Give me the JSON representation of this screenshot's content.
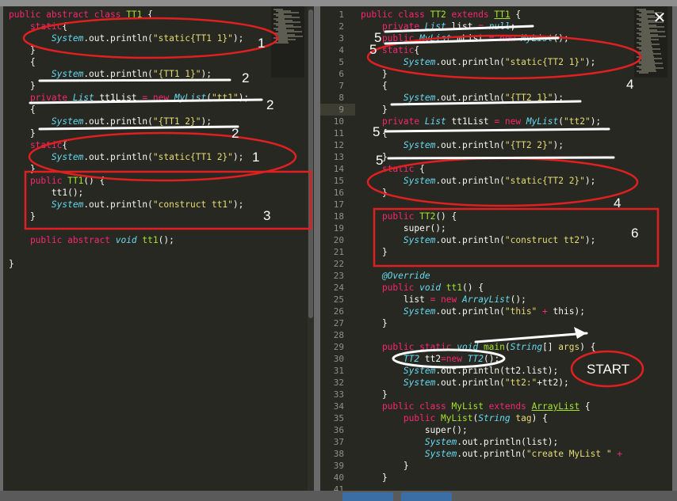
{
  "window": {
    "close_label": "✕"
  },
  "left_pane": {
    "lines": [
      [
        {
          "t": "public abstract class ",
          "c": "kw"
        },
        {
          "t": "TT1",
          "c": "fn"
        },
        {
          "t": " {",
          "c": ""
        }
      ],
      [
        {
          "t": "    static",
          "c": "kw"
        },
        {
          "t": "{",
          "c": ""
        }
      ],
      [
        {
          "t": "        ",
          "c": ""
        },
        {
          "t": "System",
          "c": "ty"
        },
        {
          "t": ".out.println(",
          "c": ""
        },
        {
          "t": "\"static{TT1 1}\"",
          "c": "st"
        },
        {
          "t": ");",
          "c": ""
        }
      ],
      [
        {
          "t": "    }",
          "c": ""
        }
      ],
      [
        {
          "t": "    {",
          "c": ""
        }
      ],
      [
        {
          "t": "        ",
          "c": ""
        },
        {
          "t": "System",
          "c": "ty"
        },
        {
          "t": ".out.println(",
          "c": ""
        },
        {
          "t": "\"{TT1 1}\"",
          "c": "st"
        },
        {
          "t": ");",
          "c": ""
        }
      ],
      [
        {
          "t": "    }",
          "c": ""
        }
      ],
      [
        {
          "t": "    private ",
          "c": "kw"
        },
        {
          "t": "List",
          "c": "ty"
        },
        {
          "t": " tt1List ",
          "c": ""
        },
        {
          "t": "= new ",
          "c": "kw"
        },
        {
          "t": "MyList",
          "c": "ty"
        },
        {
          "t": "(",
          "c": ""
        },
        {
          "t": "\"tt1\"",
          "c": "st"
        },
        {
          "t": ");",
          "c": ""
        }
      ],
      [
        {
          "t": "    {",
          "c": ""
        }
      ],
      [
        {
          "t": "        ",
          "c": ""
        },
        {
          "t": "System",
          "c": "ty"
        },
        {
          "t": ".out.println(",
          "c": ""
        },
        {
          "t": "\"{TT1 2}\"",
          "c": "st"
        },
        {
          "t": ");",
          "c": ""
        }
      ],
      [
        {
          "t": "    }",
          "c": ""
        }
      ],
      [
        {
          "t": "    static",
          "c": "kw"
        },
        {
          "t": "{",
          "c": ""
        }
      ],
      [
        {
          "t": "        ",
          "c": ""
        },
        {
          "t": "System",
          "c": "ty"
        },
        {
          "t": ".out.println(",
          "c": ""
        },
        {
          "t": "\"static{TT1 2}\"",
          "c": "st"
        },
        {
          "t": ");",
          "c": ""
        }
      ],
      [
        {
          "t": "    }",
          "c": ""
        }
      ],
      [
        {
          "t": "    public ",
          "c": "kw"
        },
        {
          "t": "TT1",
          "c": "fn"
        },
        {
          "t": "() {",
          "c": ""
        }
      ],
      [
        {
          "t": "        tt1();",
          "c": ""
        }
      ],
      [
        {
          "t": "        ",
          "c": ""
        },
        {
          "t": "System",
          "c": "ty"
        },
        {
          "t": ".out.println(",
          "c": ""
        },
        {
          "t": "\"construct tt1\"",
          "c": "st"
        },
        {
          "t": ");",
          "c": ""
        }
      ],
      [
        {
          "t": "    }",
          "c": ""
        }
      ],
      [
        {
          "t": "",
          "c": ""
        }
      ],
      [
        {
          "t": "    public abstract ",
          "c": "kw"
        },
        {
          "t": "void ",
          "c": "ty"
        },
        {
          "t": "tt1",
          "c": "fn"
        },
        {
          "t": "();",
          "c": ""
        }
      ],
      [
        {
          "t": "",
          "c": ""
        }
      ],
      [
        {
          "t": "}",
          "c": ""
        }
      ]
    ]
  },
  "right_pane": {
    "highlight_line": 9,
    "lines": [
      [
        {
          "t": "public class ",
          "c": "kw"
        },
        {
          "t": "TT2",
          "c": "fn"
        },
        {
          "t": " extends ",
          "c": "kw"
        },
        {
          "t": "TT1",
          "c": "cl"
        },
        {
          "t": " {",
          "c": ""
        }
      ],
      [
        {
          "t": "    private ",
          "c": "kw"
        },
        {
          "t": "List",
          "c": "ty"
        },
        {
          "t": " list ",
          "c": ""
        },
        {
          "t": "= ",
          "c": "kw"
        },
        {
          "t": "null",
          "c": "ty"
        },
        {
          "t": ";",
          "c": ""
        }
      ],
      [
        {
          "t": "    public ",
          "c": "kw"
        },
        {
          "t": "MyList",
          "c": "ty"
        },
        {
          "t": " mList ",
          "c": ""
        },
        {
          "t": "= new ",
          "c": "kw"
        },
        {
          "t": "MyList",
          "c": "ty"
        },
        {
          "t": "();",
          "c": ""
        }
      ],
      [
        {
          "t": "    static",
          "c": "kw"
        },
        {
          "t": "{",
          "c": ""
        }
      ],
      [
        {
          "t": "        ",
          "c": ""
        },
        {
          "t": "System",
          "c": "ty"
        },
        {
          "t": ".out.println(",
          "c": ""
        },
        {
          "t": "\"static{TT2 1}\"",
          "c": "st"
        },
        {
          "t": ");",
          "c": ""
        }
      ],
      [
        {
          "t": "    }",
          "c": ""
        }
      ],
      [
        {
          "t": "    {",
          "c": ""
        }
      ],
      [
        {
          "t": "        ",
          "c": ""
        },
        {
          "t": "System",
          "c": "ty"
        },
        {
          "t": ".out.println(",
          "c": ""
        },
        {
          "t": "\"{TT2 1}\"",
          "c": "st"
        },
        {
          "t": ");",
          "c": ""
        }
      ],
      [
        {
          "t": "    }",
          "c": ""
        }
      ],
      [
        {
          "t": "    private ",
          "c": "kw"
        },
        {
          "t": "List",
          "c": "ty"
        },
        {
          "t": " tt1List ",
          "c": ""
        },
        {
          "t": "= new ",
          "c": "kw"
        },
        {
          "t": "MyList",
          "c": "ty"
        },
        {
          "t": "(",
          "c": ""
        },
        {
          "t": "\"tt2\"",
          "c": "st"
        },
        {
          "t": ");",
          "c": ""
        }
      ],
      [
        {
          "t": "    {",
          "c": ""
        }
      ],
      [
        {
          "t": "        ",
          "c": ""
        },
        {
          "t": "System",
          "c": "ty"
        },
        {
          "t": ".out.println(",
          "c": ""
        },
        {
          "t": "\"{TT2 2}\"",
          "c": "st"
        },
        {
          "t": ");",
          "c": ""
        }
      ],
      [
        {
          "t": "    }",
          "c": ""
        }
      ],
      [
        {
          "t": "    static ",
          "c": "kw"
        },
        {
          "t": "{",
          "c": ""
        }
      ],
      [
        {
          "t": "        ",
          "c": ""
        },
        {
          "t": "System",
          "c": "ty"
        },
        {
          "t": ".out.println(",
          "c": ""
        },
        {
          "t": "\"static{TT2 2}\"",
          "c": "st"
        },
        {
          "t": ");",
          "c": ""
        }
      ],
      [
        {
          "t": "    }",
          "c": ""
        }
      ],
      [
        {
          "t": "",
          "c": ""
        }
      ],
      [
        {
          "t": "    public ",
          "c": "kw"
        },
        {
          "t": "TT2",
          "c": "fn"
        },
        {
          "t": "() {",
          "c": ""
        }
      ],
      [
        {
          "t": "        super();",
          "c": ""
        }
      ],
      [
        {
          "t": "        ",
          "c": ""
        },
        {
          "t": "System",
          "c": "ty"
        },
        {
          "t": ".out.println(",
          "c": ""
        },
        {
          "t": "\"construct tt2\"",
          "c": "st"
        },
        {
          "t": ");",
          "c": ""
        }
      ],
      [
        {
          "t": "    }",
          "c": ""
        }
      ],
      [
        {
          "t": "",
          "c": ""
        }
      ],
      [
        {
          "t": "    @Override",
          "c": "ty"
        }
      ],
      [
        {
          "t": "    public ",
          "c": "kw"
        },
        {
          "t": "void ",
          "c": "ty"
        },
        {
          "t": "tt1",
          "c": "fn"
        },
        {
          "t": "() {",
          "c": ""
        }
      ],
      [
        {
          "t": "        list ",
          "c": ""
        },
        {
          "t": "= new ",
          "c": "kw"
        },
        {
          "t": "ArrayList",
          "c": "ty"
        },
        {
          "t": "();",
          "c": ""
        }
      ],
      [
        {
          "t": "        ",
          "c": ""
        },
        {
          "t": "System",
          "c": "ty"
        },
        {
          "t": ".out.println(",
          "c": ""
        },
        {
          "t": "\"this\"",
          "c": "st"
        },
        {
          "t": " + ",
          "c": "kw"
        },
        {
          "t": "this);",
          "c": ""
        }
      ],
      [
        {
          "t": "    }",
          "c": ""
        }
      ],
      [
        {
          "t": "",
          "c": ""
        }
      ],
      [
        {
          "t": "    public static ",
          "c": "kw"
        },
        {
          "t": "void ",
          "c": "ty"
        },
        {
          "t": "main",
          "c": "fn"
        },
        {
          "t": "(",
          "c": ""
        },
        {
          "t": "String",
          "c": "ty"
        },
        {
          "t": "[] ",
          "c": ""
        },
        {
          "t": "args",
          "c": "st"
        },
        {
          "t": ") {",
          "c": ""
        }
      ],
      [
        {
          "t": "        ",
          "c": ""
        },
        {
          "t": "TT2",
          "c": "ty"
        },
        {
          "t": " tt2",
          "c": ""
        },
        {
          "t": "=new ",
          "c": "kw"
        },
        {
          "t": "TT2",
          "c": "ty"
        },
        {
          "t": "();",
          "c": ""
        }
      ],
      [
        {
          "t": "        ",
          "c": ""
        },
        {
          "t": "System",
          "c": "ty"
        },
        {
          "t": ".out.println(tt2.list);",
          "c": ""
        }
      ],
      [
        {
          "t": "        ",
          "c": ""
        },
        {
          "t": "System",
          "c": "ty"
        },
        {
          "t": ".out.println(",
          "c": ""
        },
        {
          "t": "\"tt2:\"",
          "c": "st"
        },
        {
          "t": "+tt2);",
          "c": ""
        }
      ],
      [
        {
          "t": "    }",
          "c": ""
        }
      ],
      [
        {
          "t": "    public class ",
          "c": "kw"
        },
        {
          "t": "MyList",
          "c": "fn"
        },
        {
          "t": " extends ",
          "c": "kw"
        },
        {
          "t": "ArrayList",
          "c": "cl"
        },
        {
          "t": " {",
          "c": ""
        }
      ],
      [
        {
          "t": "        public ",
          "c": "kw"
        },
        {
          "t": "MyList",
          "c": "fn"
        },
        {
          "t": "(",
          "c": ""
        },
        {
          "t": "String",
          "c": "ty"
        },
        {
          "t": " tag",
          "c": "st"
        },
        {
          "t": ") {",
          "c": ""
        }
      ],
      [
        {
          "t": "            super();",
          "c": ""
        }
      ],
      [
        {
          "t": "            ",
          "c": ""
        },
        {
          "t": "System",
          "c": "ty"
        },
        {
          "t": ".out.println(list);",
          "c": ""
        }
      ],
      [
        {
          "t": "            ",
          "c": ""
        },
        {
          "t": "System",
          "c": "ty"
        },
        {
          "t": ".out.println(",
          "c": ""
        },
        {
          "t": "\"create MyList \"",
          "c": "st"
        },
        {
          "t": " +",
          "c": "kw"
        }
      ],
      [
        {
          "t": "        }",
          "c": ""
        }
      ],
      [
        {
          "t": "    }",
          "c": ""
        }
      ],
      [
        {
          "t": "",
          "c": ""
        }
      ]
    ]
  },
  "annotations": {
    "labels": [
      "1",
      "2",
      "2",
      "2",
      "1",
      "3",
      "5",
      "5",
      "4",
      "5",
      "5",
      "4",
      "6"
    ],
    "start_label": "START"
  }
}
